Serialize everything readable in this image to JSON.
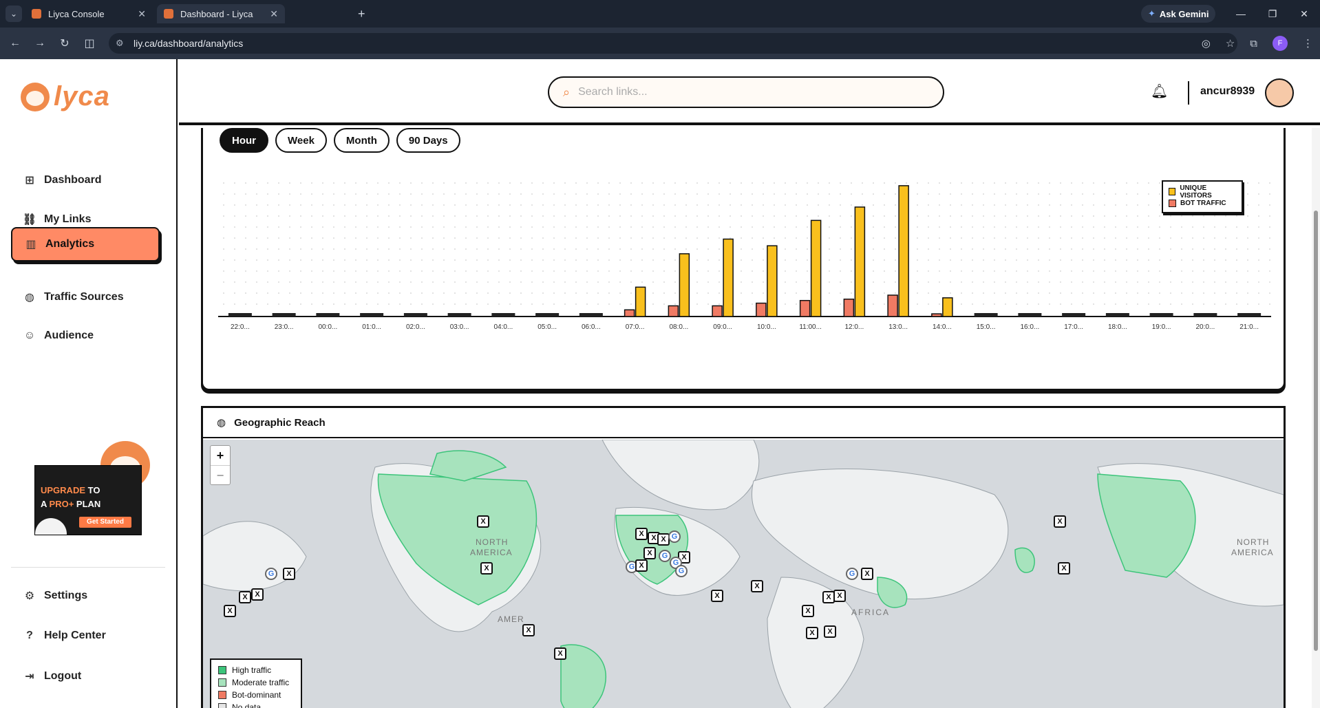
{
  "browser": {
    "tabs": [
      {
        "title": "Liyca Console"
      },
      {
        "title": "Dashboard - Liyca"
      }
    ],
    "url": "liy.ca/dashboard/analytics",
    "ask_gemini": "Ask Gemini",
    "profile_initial": "F"
  },
  "sidebar": {
    "logo_text": "lyca",
    "items": [
      {
        "label": "Dashboard",
        "icon": "grid-icon"
      },
      {
        "label": "My Links",
        "icon": "link-icon"
      },
      {
        "label": "Analytics",
        "icon": "bar-chart-icon",
        "active": true
      },
      {
        "label": "Traffic Sources",
        "icon": "globe-icon"
      },
      {
        "label": "Audience",
        "icon": "users-icon"
      }
    ],
    "promo": {
      "line1_a": "UPGRADE",
      "line1_b": " TO",
      "line2_a": "A ",
      "line2_b": "PRO+",
      "line2_c": " PLAN",
      "cta": "Get Started"
    },
    "bottom_items": [
      {
        "label": "Settings",
        "icon": "gear-icon"
      },
      {
        "label": "Help Center",
        "icon": "help-icon"
      },
      {
        "label": "Logout",
        "icon": "logout-icon"
      }
    ]
  },
  "topbar": {
    "search_placeholder": "Search links...",
    "username": "ancur8939"
  },
  "periods": [
    "Hour",
    "Week",
    "Month",
    "90 Days"
  ],
  "active_period": "Hour",
  "colors": {
    "unique": "#f9c01d",
    "bot": "#f07a63",
    "accent": "#ff8a65",
    "high": "#3cc47a",
    "moderate": "#a7e3bd"
  },
  "chart_data": {
    "type": "bar",
    "categories": [
      "22:0...",
      "23:0...",
      "00:0...",
      "01:0...",
      "02:0...",
      "03:0...",
      "04:0...",
      "05:0...",
      "06:0...",
      "07:0...",
      "08:0...",
      "09:0...",
      "10:0...",
      "11:00...",
      "12:0...",
      "13:0...",
      "14:0...",
      "15:0...",
      "16:0...",
      "17:0...",
      "18:0...",
      "19:0...",
      "20:0...",
      "21:0..."
    ],
    "series": [
      {
        "name": "UNIQUE VISITORS",
        "values": [
          0,
          0,
          0,
          0,
          0,
          0,
          0,
          0,
          0,
          22,
          47,
          58,
          53,
          72,
          82,
          98,
          14,
          0,
          0,
          0,
          0,
          0,
          0,
          0
        ]
      },
      {
        "name": "BOT TRAFFIC",
        "values": [
          0,
          0,
          0,
          0,
          0,
          0,
          0,
          0,
          0,
          5,
          8,
          8,
          10,
          12,
          13,
          16,
          2,
          0,
          0,
          0,
          0,
          0,
          0,
          0
        ]
      }
    ],
    "ylim": [
      0,
      100
    ],
    "grid": "dotted",
    "legend": "top-right"
  },
  "geo": {
    "title": "Geographic Reach",
    "zoom_in": "+",
    "zoom_out": "−",
    "region_labels": [
      "NORTH",
      "AMERICA",
      "NORTH",
      "AMERICA",
      "AFRICA",
      "AMER"
    ],
    "legend": [
      {
        "label": "High traffic",
        "color": "#3cc47a"
      },
      {
        "label": "Moderate traffic",
        "color": "#a7e3bd"
      },
      {
        "label": "Bot-dominant",
        "color": "#f07a63"
      },
      {
        "label": "No data",
        "color": "#e5e5e5"
      }
    ]
  }
}
